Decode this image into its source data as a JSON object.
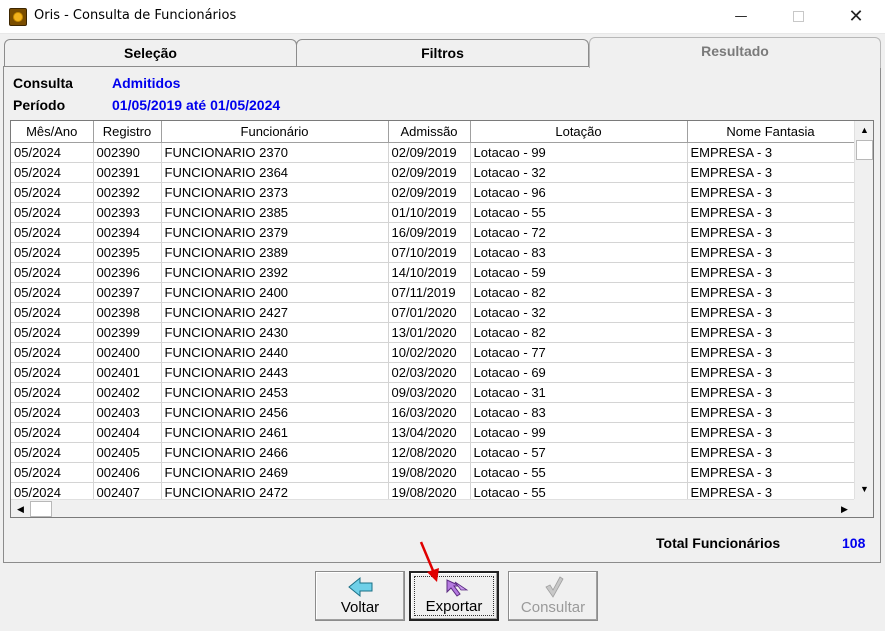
{
  "window": {
    "title": "Oris - Consulta de Funcionários",
    "minimize": "—",
    "close": "✕"
  },
  "tabs": {
    "selecao": "Seleção",
    "filtros": "Filtros",
    "resultado": "Resultado"
  },
  "info": {
    "consulta_label": "Consulta",
    "consulta_value": "Admitidos",
    "periodo_label": "Período",
    "periodo_value": "01/05/2019 até 01/05/2024"
  },
  "grid": {
    "columns": [
      "Mês/Ano",
      "Registro",
      "Funcionário",
      "Admissão",
      "Lotação",
      "Nome Fantasia"
    ],
    "rows": [
      [
        "05/2024",
        "002390",
        "FUNCIONARIO 2370",
        "02/09/2019",
        "Lotacao - 99",
        "EMPRESA - 3"
      ],
      [
        "05/2024",
        "002391",
        "FUNCIONARIO 2364",
        "02/09/2019",
        "Lotacao - 32",
        "EMPRESA - 3"
      ],
      [
        "05/2024",
        "002392",
        "FUNCIONARIO 2373",
        "02/09/2019",
        "Lotacao - 96",
        "EMPRESA - 3"
      ],
      [
        "05/2024",
        "002393",
        "FUNCIONARIO 2385",
        "01/10/2019",
        "Lotacao - 55",
        "EMPRESA - 3"
      ],
      [
        "05/2024",
        "002394",
        "FUNCIONARIO 2379",
        "16/09/2019",
        "Lotacao - 72",
        "EMPRESA - 3"
      ],
      [
        "05/2024",
        "002395",
        "FUNCIONARIO 2389",
        "07/10/2019",
        "Lotacao - 83",
        "EMPRESA - 3"
      ],
      [
        "05/2024",
        "002396",
        "FUNCIONARIO 2392",
        "14/10/2019",
        "Lotacao - 59",
        "EMPRESA - 3"
      ],
      [
        "05/2024",
        "002397",
        "FUNCIONARIO 2400",
        "07/11/2019",
        "Lotacao - 82",
        "EMPRESA - 3"
      ],
      [
        "05/2024",
        "002398",
        "FUNCIONARIO 2427",
        "07/01/2020",
        "Lotacao - 32",
        "EMPRESA - 3"
      ],
      [
        "05/2024",
        "002399",
        "FUNCIONARIO 2430",
        "13/01/2020",
        "Lotacao - 82",
        "EMPRESA - 3"
      ],
      [
        "05/2024",
        "002400",
        "FUNCIONARIO 2440",
        "10/02/2020",
        "Lotacao - 77",
        "EMPRESA - 3"
      ],
      [
        "05/2024",
        "002401",
        "FUNCIONARIO 2443",
        "02/03/2020",
        "Lotacao - 69",
        "EMPRESA - 3"
      ],
      [
        "05/2024",
        "002402",
        "FUNCIONARIO 2453",
        "09/03/2020",
        "Lotacao - 31",
        "EMPRESA - 3"
      ],
      [
        "05/2024",
        "002403",
        "FUNCIONARIO 2456",
        "16/03/2020",
        "Lotacao - 83",
        "EMPRESA - 3"
      ],
      [
        "05/2024",
        "002404",
        "FUNCIONARIO 2461",
        "13/04/2020",
        "Lotacao - 99",
        "EMPRESA - 3"
      ],
      [
        "05/2024",
        "002405",
        "FUNCIONARIO 2466",
        "12/08/2020",
        "Lotacao - 57",
        "EMPRESA - 3"
      ],
      [
        "05/2024",
        "002406",
        "FUNCIONARIO 2469",
        "19/08/2020",
        "Lotacao - 55",
        "EMPRESA - 3"
      ],
      [
        "05/2024",
        "002407",
        "FUNCIONARIO 2472",
        "19/08/2020",
        "Lotacao - 55",
        "EMPRESA - 3"
      ]
    ]
  },
  "total": {
    "label": "Total Funcionários",
    "value": "108"
  },
  "buttons": {
    "voltar": {
      "label": "Voltar",
      "icon": "arrow-left-icon"
    },
    "exportar": {
      "label": "Exportar",
      "icon": "export-icon"
    },
    "consultar": {
      "label": "Consultar",
      "icon": "checkmark-icon"
    }
  },
  "colors": {
    "accent_value": "#0000ee",
    "annotation_arrow": "#e00000"
  }
}
